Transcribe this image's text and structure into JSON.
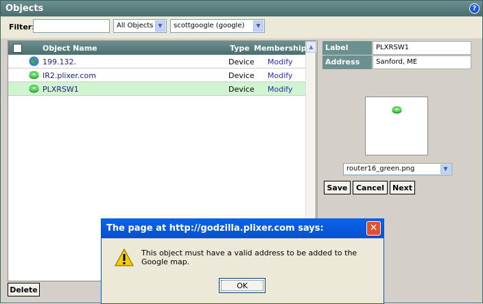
{
  "window": {
    "title": "Objects",
    "help_glyph": "?"
  },
  "filter": {
    "label": "Filter:",
    "input_value": "",
    "object_type": "All Objects",
    "account": "scottgoogle (google)"
  },
  "list": {
    "headers": {
      "name": "Object Name",
      "type": "Type",
      "membership": "Membership"
    },
    "rows": [
      {
        "name": "199.132.",
        "type": "Device",
        "membership": "Modify",
        "icon": "globe-icon",
        "selected": false
      },
      {
        "name": "IR2.plixer.com",
        "type": "Device",
        "membership": "Modify",
        "icon": "router-icon",
        "selected": false
      },
      {
        "name": "PLXRSW1",
        "type": "Device",
        "membership": "Modify",
        "icon": "router-icon",
        "selected": true
      }
    ],
    "delete_label": "Delete"
  },
  "properties": {
    "label_key": "Label",
    "label_value": "PLXRSW1",
    "address_key": "Address",
    "address_value": "Sanford, ME",
    "icon_file": "router16_green.png",
    "save_label": "Save",
    "cancel_label": "Cancel",
    "next_label": "Next"
  },
  "dialog": {
    "title": "The page at http://godzilla.plixer.com says:",
    "message": "This object must have a valid address to be added to the Google map.",
    "ok_label": "OK",
    "close_glyph": "✕"
  },
  "colors": {
    "header_teal": "#5a7e7e",
    "selected_row": "#cff4cf",
    "dialog_blue": "#0a5ad8",
    "link": "#2a2ab0"
  }
}
